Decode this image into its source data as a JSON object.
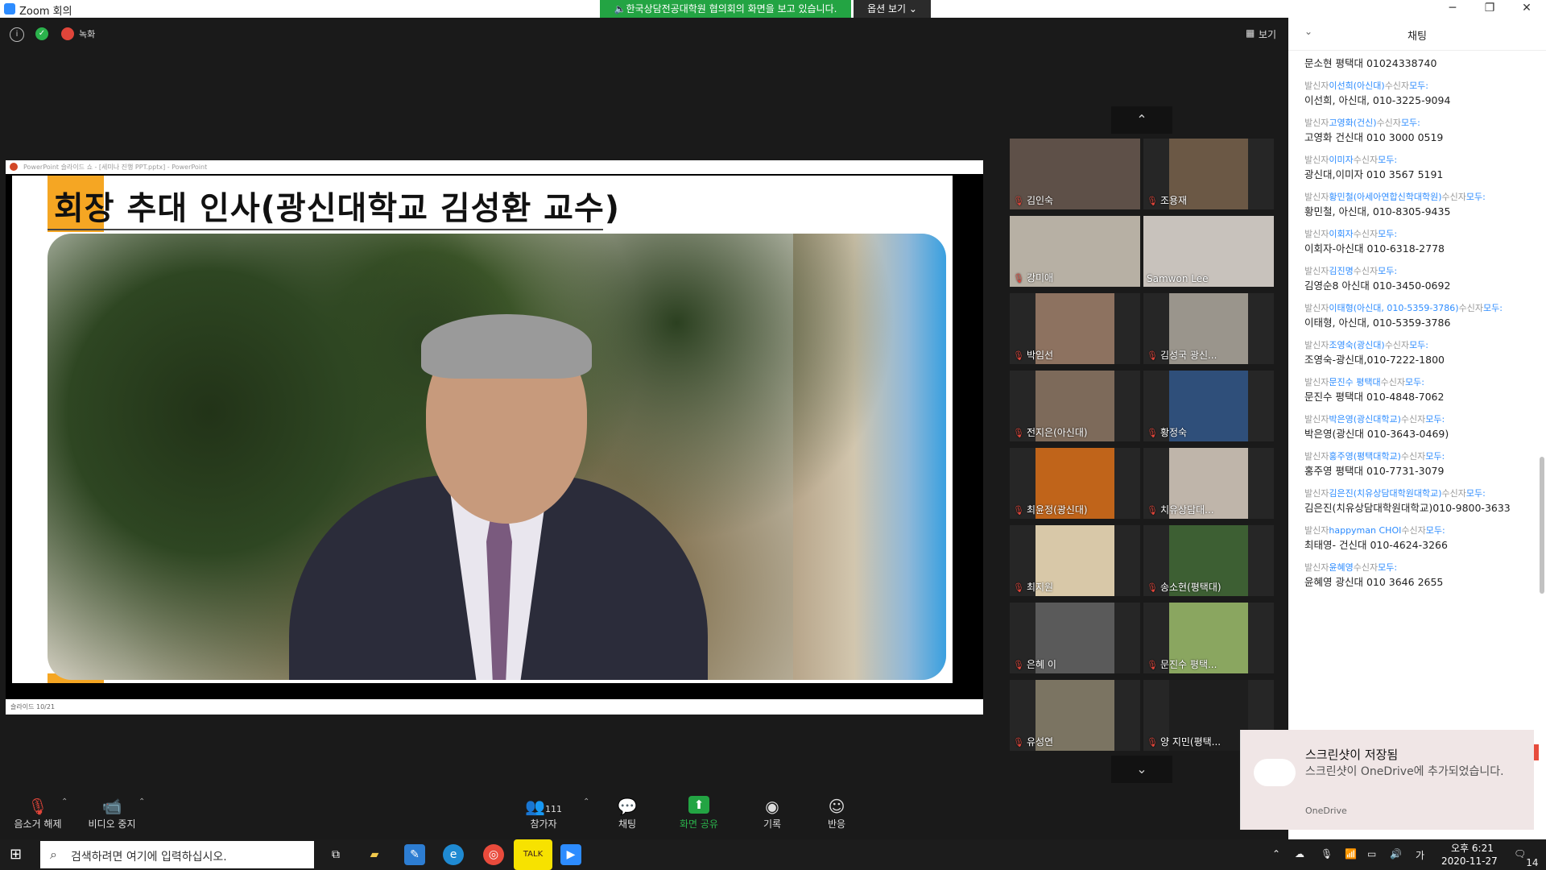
{
  "window": {
    "title": "Zoom 회의",
    "minimize": "─",
    "maximize": "❐",
    "close": "✕"
  },
  "share_banner": "한국상담전공대학원 협의회의 화면을 보고 있습니다.",
  "view_options_label": "옵션 보기 ⌄",
  "top_bar": {
    "record_label": "녹화",
    "view_label": "보기"
  },
  "shared_screen": {
    "app_title": "PowerPoint 슬라이드 쇼 - [세미나 진행 PPT.pptx] - PowerPoint",
    "slide_title": "회장 추대 인사(광신대학교 김성환 교수)",
    "status": "슬라이드 10/21"
  },
  "gallery": {
    "up_arrow": "⌃",
    "down_arrow": "⌄",
    "participants": [
      {
        "name": "김인숙",
        "muted": true,
        "color": "#5e5048"
      },
      {
        "name": "조용재",
        "muted": true,
        "color": "#6b5845"
      },
      {
        "name": "강미애",
        "muted": true,
        "color": "#b7b0a4"
      },
      {
        "name": "Samwon Lee",
        "muted": false,
        "color": "#c8c2bc"
      },
      {
        "name": "박임선",
        "muted": true,
        "color": "#8d7260"
      },
      {
        "name": "김성국 광신...",
        "muted": true,
        "color": "#9a958c"
      },
      {
        "name": "전지은(아신대)",
        "muted": true,
        "color": "#7d6a5a"
      },
      {
        "name": "황정숙",
        "muted": true,
        "color": "#2f4f7a"
      },
      {
        "name": "최윤정(광신대)",
        "muted": true,
        "color": "#c0641a"
      },
      {
        "name": "치유상담대...",
        "muted": true,
        "color": "#bfb5aa"
      },
      {
        "name": "최지원",
        "muted": true,
        "color": "#d8c8a8"
      },
      {
        "name": "송소현(평택대)",
        "muted": true,
        "color": "#3d5f33"
      },
      {
        "name": "은혜 이",
        "muted": true,
        "color": "#5a5a5a"
      },
      {
        "name": "문진수 평택...",
        "muted": true,
        "color": "#8aa660"
      },
      {
        "name": "유성연",
        "muted": true,
        "color": "#7b7462"
      },
      {
        "name": "양 지민(평택...",
        "muted": true,
        "color": "#1e1e1e"
      }
    ]
  },
  "chat": {
    "title": "채팅",
    "messages": [
      {
        "header": "",
        "text": "문소현 평택대 01024338740"
      },
      {
        "header": {
          "pre": "발신자",
          "from": "이선희(아신대)",
          "mid": "수신자",
          "to": "모두:"
        },
        "text": "이선희, 아신대, 010-3225-9094"
      },
      {
        "header": {
          "pre": "발신자",
          "from": "고영화(건신)",
          "mid": "수신자",
          "to": "모두:"
        },
        "text": "고영화 건신대 010 3000 0519"
      },
      {
        "header": {
          "pre": "발신자",
          "from": "이미자",
          "mid": "수신자",
          "to": "모두:"
        },
        "text": "광신대,이미자 010 3567 5191"
      },
      {
        "header": {
          "pre": "발신자",
          "from": "황민철(아세아연합신학대학원)",
          "mid": "수신자",
          "to": "모두:"
        },
        "text": "황민철, 아신대, 010-8305-9435"
      },
      {
        "header": {
          "pre": "발신자",
          "from": "이회자",
          "mid": "수신자",
          "to": "모두:"
        },
        "text": "이회자-아신대 010-6318-2778"
      },
      {
        "header": {
          "pre": "발신자",
          "from": "김진명",
          "mid": "수신자",
          "to": "모두:"
        },
        "text": "김영순8 아신대 010-3450-0692"
      },
      {
        "header": {
          "pre": "발신자",
          "from": "이태형(아신대, 010-5359-3786)",
          "mid": "수신자",
          "to": "모두:"
        },
        "text": "이태형, 아신대, 010-5359-3786"
      },
      {
        "header": {
          "pre": "발신자",
          "from": "조영숙(광신대)",
          "mid": "수신자",
          "to": "모두:"
        },
        "text": "조영숙-광신대,010-7222-1800"
      },
      {
        "header": {
          "pre": "발신자",
          "from": "문진수 평택대",
          "mid": "수신자",
          "to": "모두:"
        },
        "text": "문진수 평택대 010-4848-7062"
      },
      {
        "header": {
          "pre": "발신자",
          "from": "박은영(광신대학교)",
          "mid": "수신자",
          "to": "모두:"
        },
        "text": "박은영(광신대 010-3643-0469)"
      },
      {
        "header": {
          "pre": "발신자",
          "from": "홍주영(평택대학교)",
          "mid": "수신자",
          "to": "모두:"
        },
        "text": "홍주영 평택대 010-7731-3079"
      },
      {
        "header": {
          "pre": "발신자",
          "from": "김은진(치유상담대학원대학교)",
          "mid": "수신자",
          "to": "모두:"
        },
        "text": "김은진(치유상담대학원대학교)010-9800-3633"
      },
      {
        "header": {
          "pre": "발신자",
          "from": "happyman CHOI",
          "mid": "수신자",
          "to": "모두:"
        },
        "text": "최태영- 건신대 010-4624-3266"
      },
      {
        "header": {
          "pre": "발신자",
          "from": "윤혜영",
          "mid": "수신자",
          "to": "모두:"
        },
        "text": "윤혜영 광신대 010 3646 2655"
      }
    ]
  },
  "toolbar": {
    "unmute": "음소거 해제",
    "stop_video": "비디오 중지",
    "participants": "참가자",
    "participant_count": "111",
    "chat": "채팅",
    "share_screen": "화면 공유",
    "record": "기록",
    "reactions": "반응"
  },
  "toast": {
    "title": "스크린샷이 저장됨",
    "body": "스크린샷이 OneDrive에 추가되었습니다.",
    "app": "OneDrive"
  },
  "taskbar": {
    "search_placeholder": "검색하려면 여기에 입력하십시오.",
    "ime": "가",
    "time": "오후 6:21",
    "date": "2020-11-27",
    "notifications": "14"
  }
}
